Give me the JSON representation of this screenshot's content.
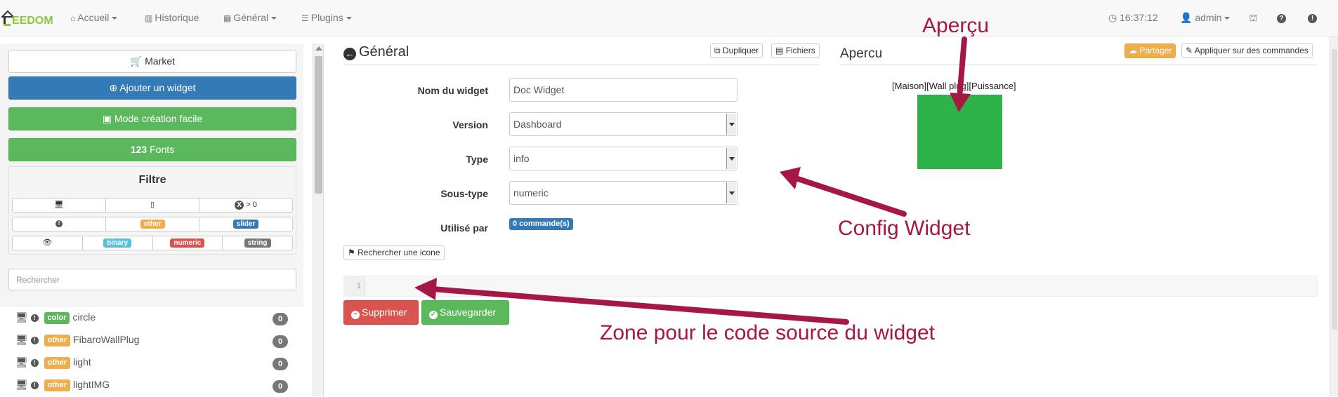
{
  "navbar": {
    "logo_text": "EEDOM",
    "items": [
      {
        "label": "Accueil"
      },
      {
        "label": "Historique"
      },
      {
        "label": "Général"
      },
      {
        "label": "Plugins"
      }
    ],
    "time": "16:37:12",
    "user": "admin"
  },
  "sidebar": {
    "market_label": "Market",
    "add_widget_label": "Ajouter un widget",
    "easy_mode_label": "Mode création facile",
    "fonts_label": "Fonts",
    "filter_title": "Filtre",
    "filter_count_text": "> 0",
    "filter_tags_row2": [
      "other",
      "slider"
    ],
    "filter_tags_row3": [
      "binary",
      "numeric",
      "string"
    ],
    "search_placeholder": "Rechercher",
    "widgets": [
      {
        "tag": "color",
        "name": "circle",
        "count": "0"
      },
      {
        "tag": "other",
        "name": "FibaroWallPlug",
        "count": "0"
      },
      {
        "tag": "other",
        "name": "light",
        "count": "0"
      },
      {
        "tag": "other",
        "name": "lightIMG",
        "count": "0"
      }
    ]
  },
  "main": {
    "title": "Général",
    "duplicate_label": "Dupliquer",
    "files_label": "Fichiers",
    "form": {
      "name_label": "Nom du widget",
      "name_value": "Doc Widget",
      "version_label": "Version",
      "version_value": "Dashboard",
      "type_label": "Type",
      "type_value": "info",
      "subtype_label": "Sous-type",
      "subtype_value": "numeric",
      "used_by_label": "Utilisé par",
      "used_by_value": "0 commande(s)"
    },
    "search_icon_label": "Rechercher une icone",
    "code_line_number": "1",
    "delete_label": "Supprimer",
    "save_label": "Sauvegarder"
  },
  "preview": {
    "title": "Apercu",
    "share_label": "Partager",
    "apply_label": "Appliquer sur des commandes",
    "widget_label": "[Maison][Wall plug][Puissance]",
    "widget_color": "#2eb34a"
  },
  "annotations": {
    "apercu": "Aperçu",
    "config": "Config Widget",
    "code_zone": "Zone pour le code source du widget",
    "color": "#a51845"
  }
}
